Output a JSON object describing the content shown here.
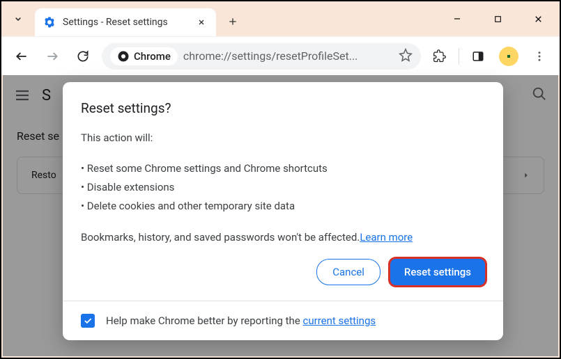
{
  "tab": {
    "title": "Settings - Reset settings"
  },
  "toolbar": {
    "chrome_chip": "Chrome",
    "url": "chrome://settings/resetProfileSet..."
  },
  "settings_bg": {
    "title_char": "S",
    "heading": "Reset se",
    "restore_label": "Resto"
  },
  "dialog": {
    "title": "Reset settings?",
    "intro": "This action will:",
    "bullets": [
      "• Reset some Chrome settings and Chrome shortcuts",
      "• Disable extensions",
      "• Delete cookies and other temporary site data"
    ],
    "note_prefix": "Bookmarks, history, and saved passwords won't be affected.",
    "learn_more": "Learn more",
    "cancel": "Cancel",
    "reset": "Reset settings",
    "footer_prefix": "Help make Chrome better by reporting the ",
    "footer_link": "current settings"
  }
}
